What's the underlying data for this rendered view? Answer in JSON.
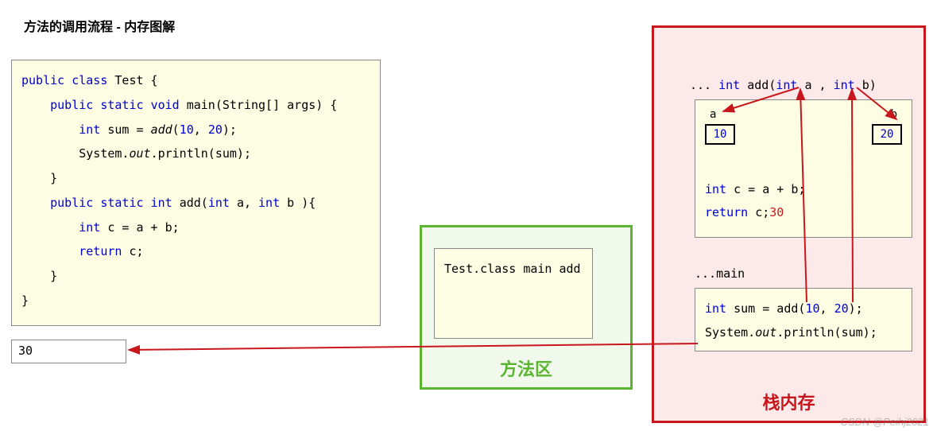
{
  "title": "方法的调用流程 - 内存图解",
  "code_lines": {
    "l1a": "public",
    "l1b": "class",
    "l1c": "Test {",
    "l2a": "public",
    "l2b": "static",
    "l2c": "void",
    "l2d": "main(String[] args) {",
    "l3a": "int",
    "l3b": "sum =",
    "l3c": "add",
    "l3d": "(",
    "l3e": "10",
    "l3f": ",",
    "l3g": "20",
    "l3h": ");",
    "l4a": "System.",
    "l4b": "out",
    "l4c": ".println(sum);",
    "l5": "}",
    "l6a": "public",
    "l6b": "static",
    "l6c": "int",
    "l6d": "add(",
    "l6e": "int",
    "l6f": "a,",
    "l6g": "int",
    "l6h": "b ){",
    "l7a": "int",
    "l7b": "c = a + b;",
    "l8a": "return",
    "l8b": "c;",
    "l9": "}",
    "l10": "}"
  },
  "output": "30",
  "method_area": {
    "label": "方法区",
    "items": {
      "i1": "Test.class",
      "i2": "main",
      "i3": "add"
    }
  },
  "stack": {
    "label": "栈内存",
    "add_sig_pre": "...",
    "add_sig_int1": "int",
    "add_sig_name": "add(",
    "add_sig_int2": "int",
    "add_sig_a": "a ,",
    "add_sig_int3": "int",
    "add_sig_b": "b)",
    "var_a_label": "a",
    "var_a_val": "10",
    "var_b_label": "b",
    "var_b_val": "20",
    "add_int": "int",
    "add_expr": "c = a + b;",
    "add_ret": "return",
    "add_retc": "c;",
    "add_30": "30",
    "main_label": "...main",
    "main_int": "int",
    "main_expr1": "sum = add(",
    "main_10": "10",
    "main_c": ",",
    "main_20": "20",
    "main_end": ");",
    "main_sys": "System.",
    "main_out": "out",
    "main_println": ".println(sum);"
  },
  "watermark": "CSDN @Peihj2021"
}
